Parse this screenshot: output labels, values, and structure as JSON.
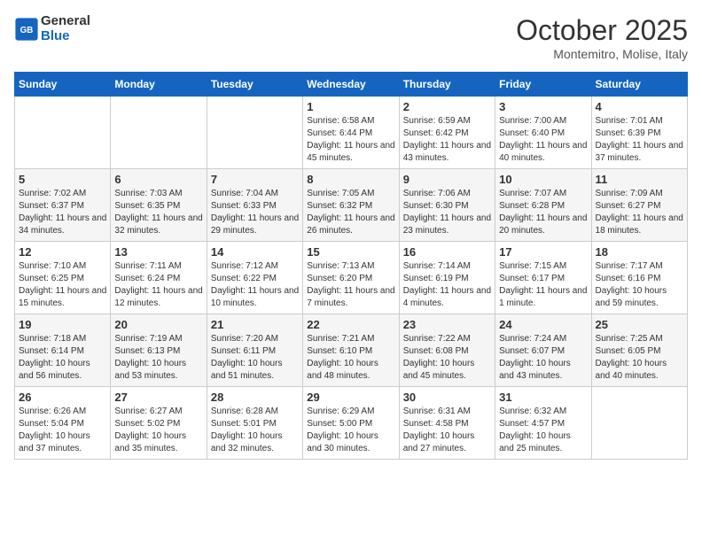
{
  "header": {
    "logo_line1": "General",
    "logo_line2": "Blue",
    "month": "October 2025",
    "location": "Montemitro, Molise, Italy"
  },
  "weekdays": [
    "Sunday",
    "Monday",
    "Tuesday",
    "Wednesday",
    "Thursday",
    "Friday",
    "Saturday"
  ],
  "weeks": [
    [
      {
        "num": "",
        "info": ""
      },
      {
        "num": "",
        "info": ""
      },
      {
        "num": "",
        "info": ""
      },
      {
        "num": "1",
        "info": "Sunrise: 6:58 AM\nSunset: 6:44 PM\nDaylight: 11 hours and 45 minutes."
      },
      {
        "num": "2",
        "info": "Sunrise: 6:59 AM\nSunset: 6:42 PM\nDaylight: 11 hours and 43 minutes."
      },
      {
        "num": "3",
        "info": "Sunrise: 7:00 AM\nSunset: 6:40 PM\nDaylight: 11 hours and 40 minutes."
      },
      {
        "num": "4",
        "info": "Sunrise: 7:01 AM\nSunset: 6:39 PM\nDaylight: 11 hours and 37 minutes."
      }
    ],
    [
      {
        "num": "5",
        "info": "Sunrise: 7:02 AM\nSunset: 6:37 PM\nDaylight: 11 hours and 34 minutes."
      },
      {
        "num": "6",
        "info": "Sunrise: 7:03 AM\nSunset: 6:35 PM\nDaylight: 11 hours and 32 minutes."
      },
      {
        "num": "7",
        "info": "Sunrise: 7:04 AM\nSunset: 6:33 PM\nDaylight: 11 hours and 29 minutes."
      },
      {
        "num": "8",
        "info": "Sunrise: 7:05 AM\nSunset: 6:32 PM\nDaylight: 11 hours and 26 minutes."
      },
      {
        "num": "9",
        "info": "Sunrise: 7:06 AM\nSunset: 6:30 PM\nDaylight: 11 hours and 23 minutes."
      },
      {
        "num": "10",
        "info": "Sunrise: 7:07 AM\nSunset: 6:28 PM\nDaylight: 11 hours and 20 minutes."
      },
      {
        "num": "11",
        "info": "Sunrise: 7:09 AM\nSunset: 6:27 PM\nDaylight: 11 hours and 18 minutes."
      }
    ],
    [
      {
        "num": "12",
        "info": "Sunrise: 7:10 AM\nSunset: 6:25 PM\nDaylight: 11 hours and 15 minutes."
      },
      {
        "num": "13",
        "info": "Sunrise: 7:11 AM\nSunset: 6:24 PM\nDaylight: 11 hours and 12 minutes."
      },
      {
        "num": "14",
        "info": "Sunrise: 7:12 AM\nSunset: 6:22 PM\nDaylight: 11 hours and 10 minutes."
      },
      {
        "num": "15",
        "info": "Sunrise: 7:13 AM\nSunset: 6:20 PM\nDaylight: 11 hours and 7 minutes."
      },
      {
        "num": "16",
        "info": "Sunrise: 7:14 AM\nSunset: 6:19 PM\nDaylight: 11 hours and 4 minutes."
      },
      {
        "num": "17",
        "info": "Sunrise: 7:15 AM\nSunset: 6:17 PM\nDaylight: 11 hours and 1 minute."
      },
      {
        "num": "18",
        "info": "Sunrise: 7:17 AM\nSunset: 6:16 PM\nDaylight: 10 hours and 59 minutes."
      }
    ],
    [
      {
        "num": "19",
        "info": "Sunrise: 7:18 AM\nSunset: 6:14 PM\nDaylight: 10 hours and 56 minutes."
      },
      {
        "num": "20",
        "info": "Sunrise: 7:19 AM\nSunset: 6:13 PM\nDaylight: 10 hours and 53 minutes."
      },
      {
        "num": "21",
        "info": "Sunrise: 7:20 AM\nSunset: 6:11 PM\nDaylight: 10 hours and 51 minutes."
      },
      {
        "num": "22",
        "info": "Sunrise: 7:21 AM\nSunset: 6:10 PM\nDaylight: 10 hours and 48 minutes."
      },
      {
        "num": "23",
        "info": "Sunrise: 7:22 AM\nSunset: 6:08 PM\nDaylight: 10 hours and 45 minutes."
      },
      {
        "num": "24",
        "info": "Sunrise: 7:24 AM\nSunset: 6:07 PM\nDaylight: 10 hours and 43 minutes."
      },
      {
        "num": "25",
        "info": "Sunrise: 7:25 AM\nSunset: 6:05 PM\nDaylight: 10 hours and 40 minutes."
      }
    ],
    [
      {
        "num": "26",
        "info": "Sunrise: 6:26 AM\nSunset: 5:04 PM\nDaylight: 10 hours and 37 minutes."
      },
      {
        "num": "27",
        "info": "Sunrise: 6:27 AM\nSunset: 5:02 PM\nDaylight: 10 hours and 35 minutes."
      },
      {
        "num": "28",
        "info": "Sunrise: 6:28 AM\nSunset: 5:01 PM\nDaylight: 10 hours and 32 minutes."
      },
      {
        "num": "29",
        "info": "Sunrise: 6:29 AM\nSunset: 5:00 PM\nDaylight: 10 hours and 30 minutes."
      },
      {
        "num": "30",
        "info": "Sunrise: 6:31 AM\nSunset: 4:58 PM\nDaylight: 10 hours and 27 minutes."
      },
      {
        "num": "31",
        "info": "Sunrise: 6:32 AM\nSunset: 4:57 PM\nDaylight: 10 hours and 25 minutes."
      },
      {
        "num": "",
        "info": ""
      }
    ]
  ]
}
